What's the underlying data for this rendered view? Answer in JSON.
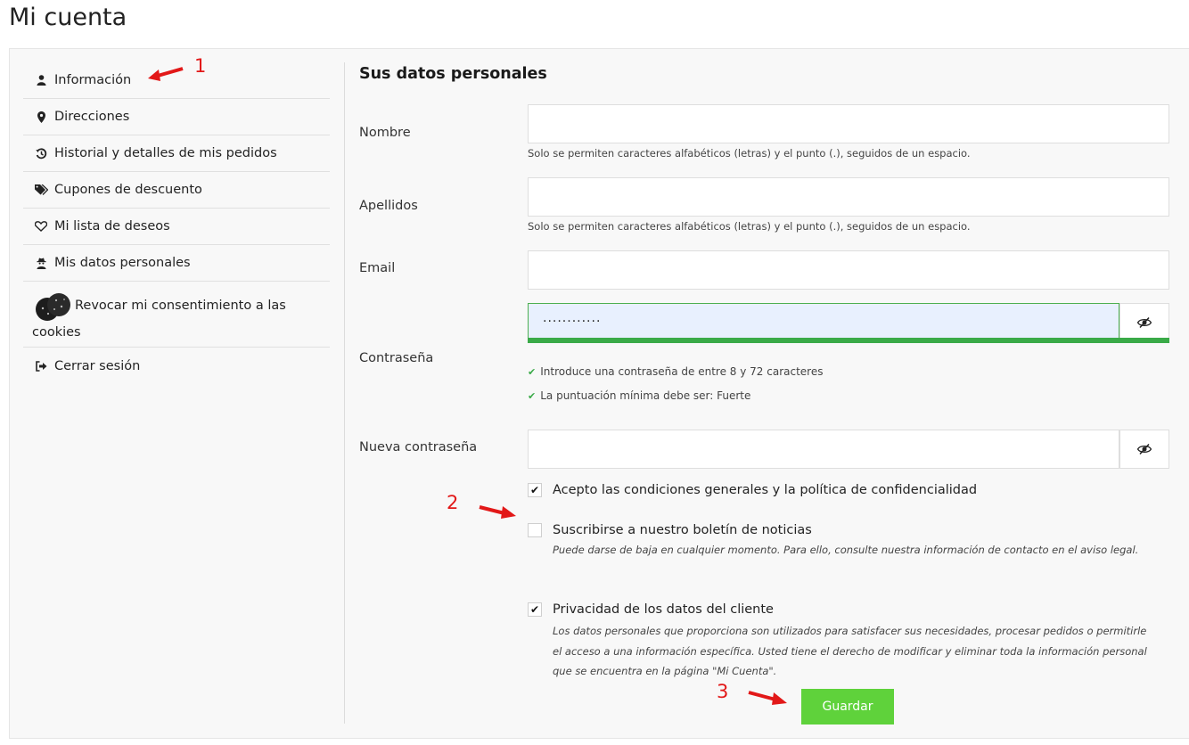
{
  "page_title": "Mi cuenta",
  "sidebar": {
    "items": [
      {
        "label": "Información",
        "icon": "user-icon"
      },
      {
        "label": "Direcciones",
        "icon": "map-marker-icon"
      },
      {
        "label": "Historial y detalles de mis pedidos",
        "icon": "history-icon"
      },
      {
        "label": "Cupones de descuento",
        "icon": "tags-icon"
      },
      {
        "label": "Mi lista de deseos",
        "icon": "heart-icon"
      },
      {
        "label": "Mis datos personales",
        "icon": "user-secret-icon"
      },
      {
        "label": "Revocar mi consentimiento a las cookies",
        "icon": "cookies-icon"
      },
      {
        "label": "Cerrar sesión",
        "icon": "sign-out-icon"
      }
    ]
  },
  "form": {
    "title": "Sus datos personales",
    "nombre": {
      "label": "Nombre",
      "value": "",
      "hint": "Solo se permiten caracteres alfabéticos (letras) y el punto (.), seguidos de un espacio."
    },
    "apellidos": {
      "label": "Apellidos",
      "value": "",
      "hint": "Solo se permiten caracteres alfabéticos (letras) y el punto (.), seguidos de un espacio."
    },
    "email": {
      "label": "Email",
      "value": ""
    },
    "password": {
      "label": "Contraseña",
      "masked_value": "············",
      "rules": [
        "Introduce una contraseña de entre 8 y 72 caracteres",
        "La puntuación mínima debe ser: Fuerte"
      ]
    },
    "new_password": {
      "label": "Nueva contraseña",
      "value": ""
    },
    "checkboxes": [
      {
        "label": "Acepto las condiciones generales y la política de confidencialidad",
        "checked": true,
        "description": ""
      },
      {
        "label": "Suscribirse a nuestro boletín de noticias",
        "checked": false,
        "description": "Puede darse de baja en cualquier momento. Para ello, consulte nuestra información de contacto en el aviso legal."
      },
      {
        "label": "Privacidad de los datos del cliente",
        "checked": true,
        "description": "Los datos personales que proporciona son utilizados para satisfacer sus necesidades, procesar pedidos o permitirle el acceso a una información específica. Usted tiene el derecho de modificar y eliminar toda la información personal que se encuentra en la página \"Mi Cuenta\"."
      }
    ],
    "save_label": "Guardar"
  },
  "annotations": {
    "one": "1",
    "two": "2",
    "three": "3",
    "color": "#e21818"
  },
  "colors": {
    "save_button": "#5fd23b",
    "strength_bar": "#3aaa48",
    "check_mark": "#3aaa48"
  }
}
